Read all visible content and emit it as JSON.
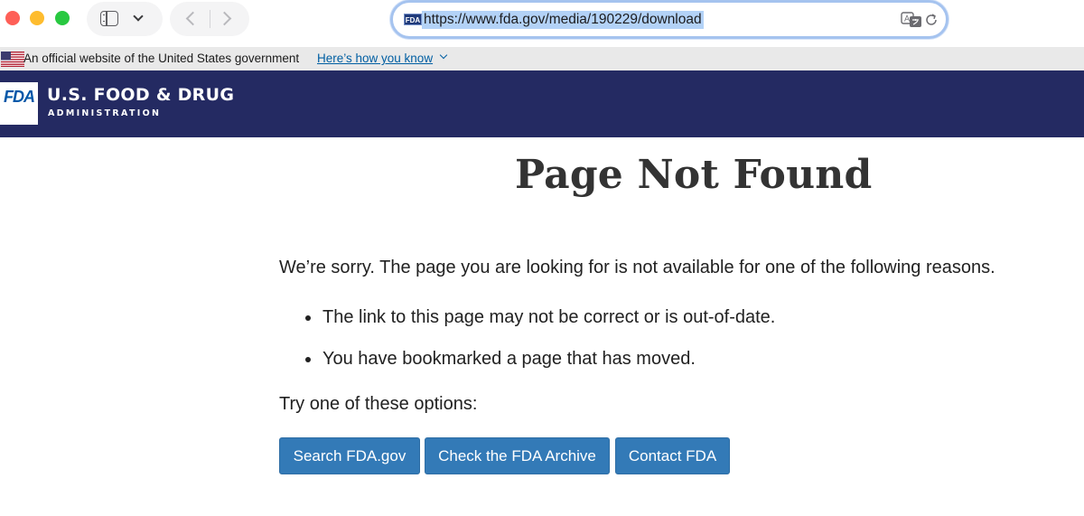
{
  "browser": {
    "url": "https://www.fda.gov/media/190229/download",
    "favicon_text": "FDA"
  },
  "gov_banner": {
    "text": "An official website of the United States government",
    "link": "Here’s how you know"
  },
  "header": {
    "logo_text": "FDA",
    "title": "U.S. FOOD & DRUG",
    "subtitle": "ADMINISTRATION",
    "background_color": "#242a62"
  },
  "main": {
    "title": "Page Not Found",
    "intro": "We’re sorry. The page you are looking for is not available for one of the following reasons.",
    "reasons": [
      "The link to this page may not be correct or is out-of-date.",
      "You have bookmarked a page that has moved."
    ],
    "options_label": "Try one of these options:",
    "buttons": [
      "Search FDA.gov",
      "Check the FDA Archive",
      "Contact FDA"
    ],
    "button_color": "#337ab7"
  }
}
